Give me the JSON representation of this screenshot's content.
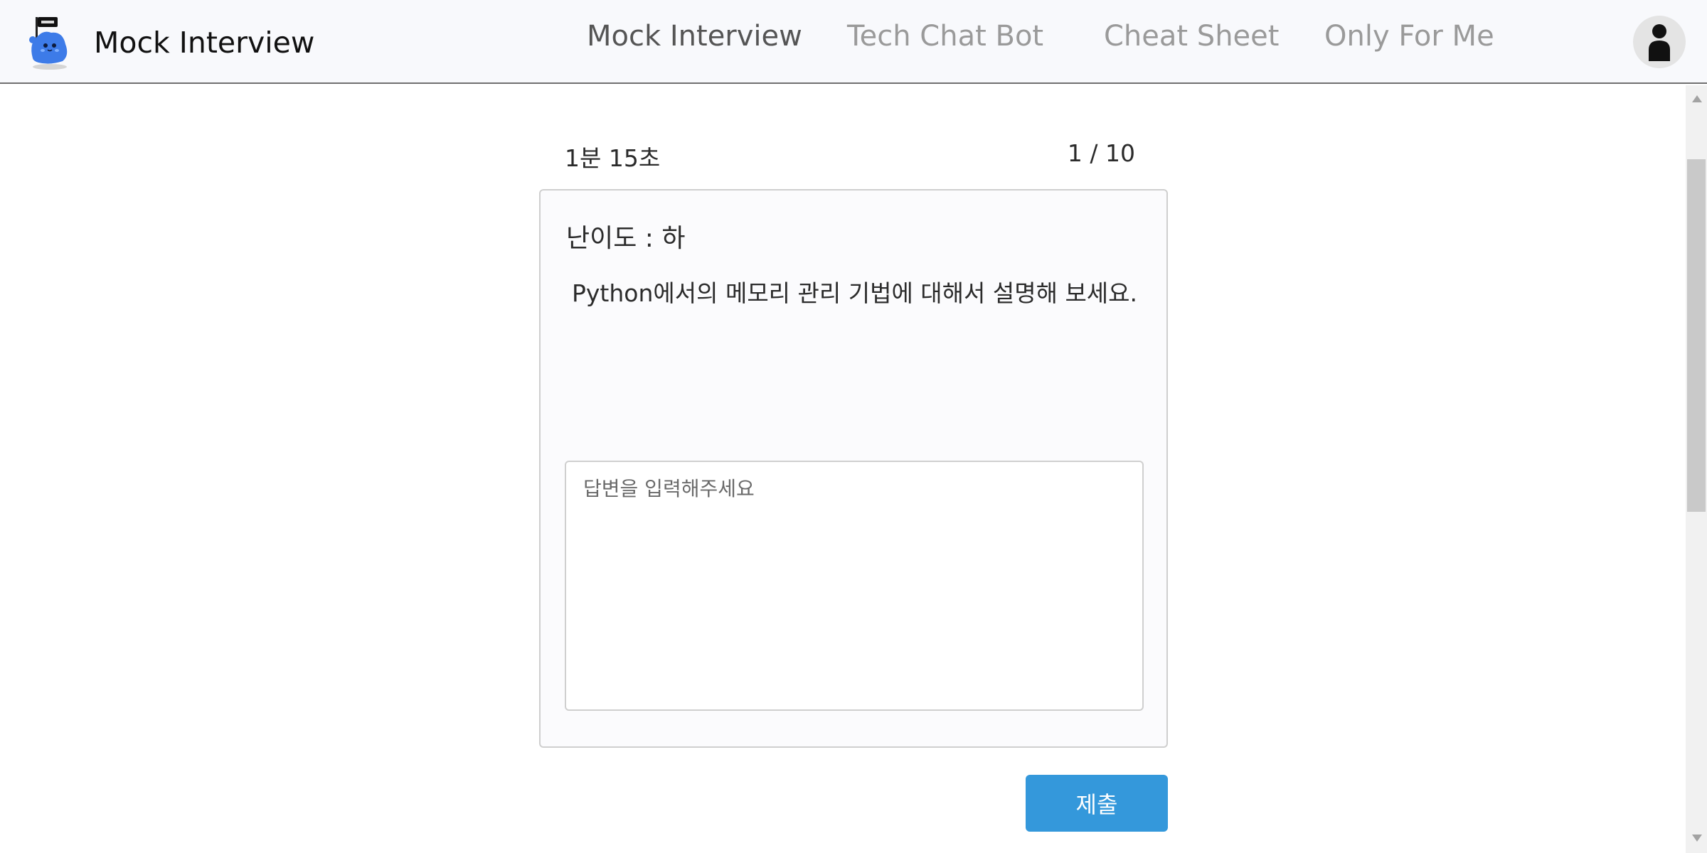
{
  "header": {
    "logo_icon": "mascot-logo-icon",
    "title": "Mock Interview",
    "nav": [
      {
        "label": "Mock Interview",
        "active": true
      },
      {
        "label": "Tech Chat Bot",
        "active": false
      },
      {
        "label": "Cheat Sheet",
        "active": false
      },
      {
        "label": "Only For Me",
        "active": false
      }
    ],
    "profile_icon": "user-icon"
  },
  "interview": {
    "timer": "1분 15초",
    "progress": "1 / 10",
    "difficulty": "난이도 : 하",
    "question": "Python에서의 메모리 관리 기법에 대해서 설명해 보세요.",
    "answer_value": "",
    "answer_placeholder": "답변을 입력해주세요",
    "submit_label": "제출"
  },
  "colors": {
    "header_bg": "#f8f9fc",
    "accent": "#3498db",
    "mascot": "#3d7be8",
    "nav_inactive": "#9a9a9a",
    "nav_active": "#555555"
  }
}
